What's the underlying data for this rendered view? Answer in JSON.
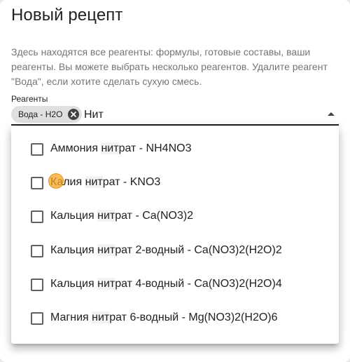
{
  "dialog": {
    "title": "Новый рецепт",
    "description": "Здесь находятся все реагенты: формулы, готовые составы, ваши реагенты. Вы можете выбрать несколько реагентов. Удалите реагент \"Вода\", если хотите сделать сухую смесь."
  },
  "reagents_field": {
    "label": "Реагенты",
    "selected_chip": "Вода - H2O",
    "chip_remove_icon": "cancel-icon",
    "input_value": "Нит",
    "toggle_icon": "arrow-up-icon"
  },
  "options": [
    {
      "before": "Аммония ",
      "match": "нит",
      "after": "рат - NH4NO3",
      "checked": false
    },
    {
      "before": "Калия ",
      "match": "нит",
      "after": "рат - KNO3",
      "checked": false
    },
    {
      "before": "Кальция ",
      "match": "нит",
      "after": "рат - Ca(NO3)2",
      "checked": false
    },
    {
      "before": "Кальция ",
      "match": "нит",
      "after": "рат 2-водный - Ca(NO3)2(H2O)2",
      "checked": false
    },
    {
      "before": "Кальция ",
      "match": "нит",
      "after": "рат 4-водный - Ca(NO3)2(H2O)4",
      "checked": false
    },
    {
      "before": "Магния ",
      "match": "нит",
      "after": "рат 6-водный - Mg(NO3)2(H2O)6",
      "checked": false
    }
  ],
  "colors": {
    "text": "#212121",
    "secondary_text": "#757575",
    "chip_bg": "#e0e0e0",
    "match_highlight": "#f2f2f2",
    "cursor_marker": "#f5a623"
  }
}
